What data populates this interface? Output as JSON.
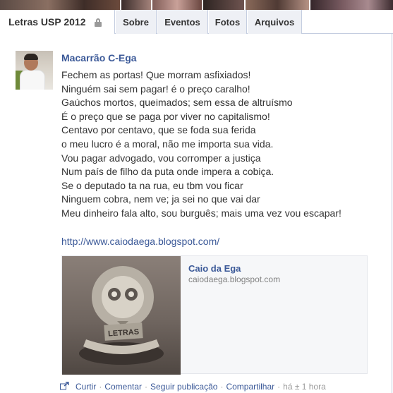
{
  "group": {
    "name": "Letras USP 2012"
  },
  "tabs": [
    {
      "label": "Sobre"
    },
    {
      "label": "Eventos"
    },
    {
      "label": "Fotos"
    },
    {
      "label": "Arquivos"
    }
  ],
  "post": {
    "author": "Macarrão C-Ega",
    "lines": [
      "Fechem as portas! Que morram asfixiados!",
      "Ninguém sai sem pagar! é o preço caralho!",
      "Gaúchos mortos, queimados; sem essa de altruísmo",
      "É o preço que se paga por viver no capitalismo!",
      "Centavo por centavo, que se foda sua ferida",
      "o meu lucro é a moral, não me importa sua vida.",
      "Vou pagar advogado, vou corromper a justiça",
      "Num país de filho da puta onde impera a cobiça.",
      "Se o deputado ta na rua, eu tbm vou ficar",
      "Ninguem cobra, nem ve; ja sei no que vai dar",
      "Meu dinheiro fala alto, sou burguês; mais uma vez vou escapar!"
    ],
    "link": "http://www.caiodaega.blogspot.com/",
    "attachment": {
      "title": "Caio da Ega",
      "url": "caiodaega.blogspot.com",
      "thumb_text": "LETRAS"
    },
    "actions": {
      "cut": "Curtir",
      "comment": "Comentar",
      "follow": "Seguir publicação",
      "share": "Compartilhar",
      "time": "há ± 1 hora"
    }
  },
  "colors": {
    "link": "#3b5998",
    "tab_bg": "#eef0f5",
    "border": "#c4cde0"
  }
}
